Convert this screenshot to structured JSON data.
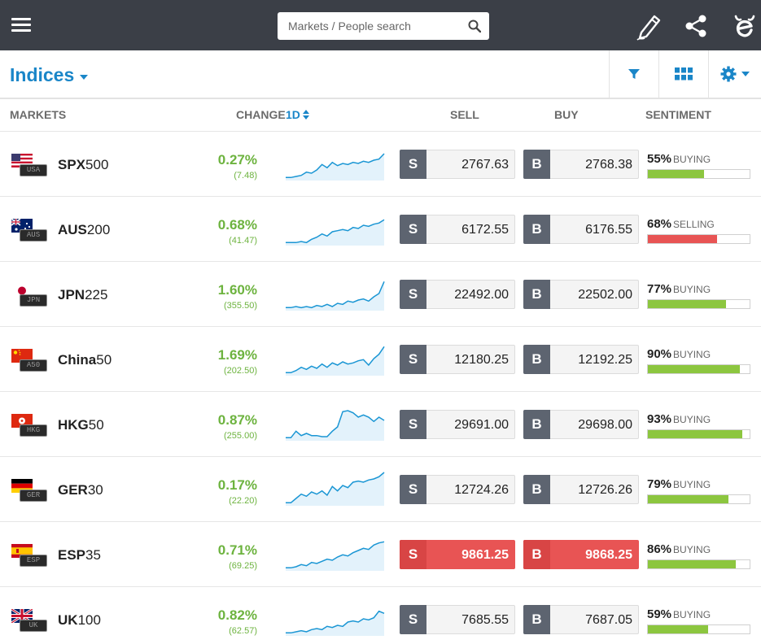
{
  "search": {
    "placeholder": "Markets / People search"
  },
  "header": {
    "title": "Indices"
  },
  "columns": {
    "markets": "MARKETS",
    "change": "CHANGE",
    "period": "1D",
    "sell": "SELL",
    "buy": "BUY",
    "sentiment": "SENTIMENT"
  },
  "trade_labels": {
    "sell": "S",
    "buy": "B"
  },
  "colors": {
    "positive": "#6db33f",
    "buying_bar": "#8cc63f",
    "selling_bar": "#e85454",
    "accent": "#1a86c8",
    "topbar": "#3b3f47",
    "sparkline": "#1a96d4"
  },
  "rows": [
    {
      "prefix": "SPX",
      "suffix": "500",
      "tag": "USA",
      "flag": "us",
      "change_pct": "0.27%",
      "change_abs": "(7.48)",
      "sell": "2767.63",
      "buy": "2768.38",
      "sentiment_pct": "55%",
      "sentiment_dir": "BUYING",
      "sentiment_value": 55,
      "highlight": false,
      "spark": [
        2,
        2,
        3,
        4,
        7,
        6,
        9,
        14,
        11,
        16,
        13,
        15,
        14,
        16,
        15,
        17,
        16,
        18,
        19,
        24
      ]
    },
    {
      "prefix": "AUS",
      "suffix": "200",
      "tag": "AUS",
      "flag": "au",
      "change_pct": "0.68%",
      "change_abs": "(41.47)",
      "sell": "6172.55",
      "buy": "6176.55",
      "sentiment_pct": "68%",
      "sentiment_dir": "SELLING",
      "sentiment_value": 68,
      "highlight": false,
      "spark": [
        2,
        2,
        2,
        3,
        2,
        5,
        7,
        10,
        8,
        12,
        13,
        14,
        13,
        16,
        15,
        18,
        17,
        19,
        20,
        23
      ]
    },
    {
      "prefix": "JPN",
      "suffix": "225",
      "tag": "JPN",
      "flag": "jp",
      "change_pct": "1.60%",
      "change_abs": "(355.50)",
      "sell": "22492.00",
      "buy": "22502.00",
      "sentiment_pct": "77%",
      "sentiment_dir": "BUYING",
      "sentiment_value": 77,
      "highlight": false,
      "spark": [
        2,
        2,
        3,
        2,
        3,
        2,
        4,
        3,
        5,
        3,
        6,
        5,
        8,
        7,
        9,
        10,
        8,
        12,
        15,
        26
      ]
    },
    {
      "prefix": "China",
      "suffix": "50",
      "tag": "A50",
      "flag": "cn",
      "change_pct": "1.69%",
      "change_abs": "(202.50)",
      "sell": "12180.25",
      "buy": "12192.25",
      "sentiment_pct": "90%",
      "sentiment_dir": "BUYING",
      "sentiment_value": 90,
      "highlight": false,
      "spark": [
        2,
        2,
        4,
        7,
        5,
        8,
        6,
        10,
        7,
        11,
        9,
        12,
        10,
        11,
        13,
        14,
        9,
        15,
        19,
        26
      ]
    },
    {
      "prefix": "HKG",
      "suffix": "50",
      "tag": "HKG",
      "flag": "hk",
      "change_pct": "0.87%",
      "change_abs": "(255.00)",
      "sell": "29691.00",
      "buy": "29698.00",
      "sentiment_pct": "93%",
      "sentiment_dir": "BUYING",
      "sentiment_value": 93,
      "highlight": false,
      "spark": [
        2,
        2,
        8,
        4,
        6,
        4,
        4,
        3,
        3,
        8,
        12,
        26,
        27,
        25,
        21,
        23,
        21,
        17,
        21,
        18
      ]
    },
    {
      "prefix": "GER",
      "suffix": "30",
      "tag": "GER",
      "flag": "de",
      "change_pct": "0.17%",
      "change_abs": "(22.20)",
      "sell": "12724.26",
      "buy": "12726.26",
      "sentiment_pct": "79%",
      "sentiment_dir": "BUYING",
      "sentiment_value": 79,
      "highlight": false,
      "spark": [
        2,
        2,
        6,
        10,
        8,
        12,
        10,
        13,
        9,
        17,
        13,
        18,
        16,
        21,
        22,
        21,
        23,
        24,
        26,
        30
      ]
    },
    {
      "prefix": "ESP",
      "suffix": "35",
      "tag": "ESP",
      "flag": "es",
      "change_pct": "0.71%",
      "change_abs": "(69.25)",
      "sell": "9861.25",
      "buy": "9868.25",
      "sentiment_pct": "86%",
      "sentiment_dir": "BUYING",
      "sentiment_value": 86,
      "highlight": true,
      "spark": [
        2,
        2,
        3,
        5,
        4,
        7,
        6,
        8,
        10,
        9,
        12,
        14,
        13,
        16,
        18,
        20,
        19,
        23,
        25,
        26
      ]
    },
    {
      "prefix": "UK",
      "suffix": "100",
      "tag": "UK",
      "flag": "gb",
      "change_pct": "0.82%",
      "change_abs": "(62.57)",
      "sell": "7685.55",
      "buy": "7687.05",
      "sentiment_pct": "59%",
      "sentiment_dir": "BUYING",
      "sentiment_value": 59,
      "highlight": false,
      "spark": [
        2,
        2,
        3,
        4,
        3,
        5,
        6,
        5,
        8,
        7,
        9,
        8,
        12,
        13,
        12,
        15,
        14,
        16,
        22,
        20
      ]
    }
  ]
}
